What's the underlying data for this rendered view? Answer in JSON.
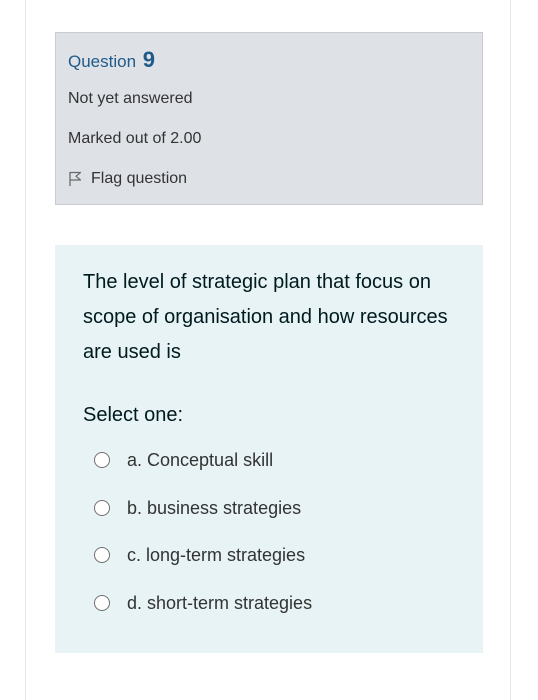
{
  "question_info": {
    "question_label": "Question",
    "question_number": "9",
    "state": "Not yet answered",
    "grade": "Marked out of 2.00",
    "flag_label": "Flag question"
  },
  "question": {
    "text": "The level of strategic plan that focus on scope of organisation and how resources are used is",
    "prompt": "Select one:",
    "options": [
      {
        "label": "a. Conceptual skill"
      },
      {
        "label": "b. business strategies"
      },
      {
        "label": "c. long-term strategies"
      },
      {
        "label": "d. short-term strategies"
      }
    ]
  },
  "colors": {
    "info_background": "#dee2e6",
    "content_background": "#e7f3f5",
    "question_number_color": "#1f5a8a"
  }
}
